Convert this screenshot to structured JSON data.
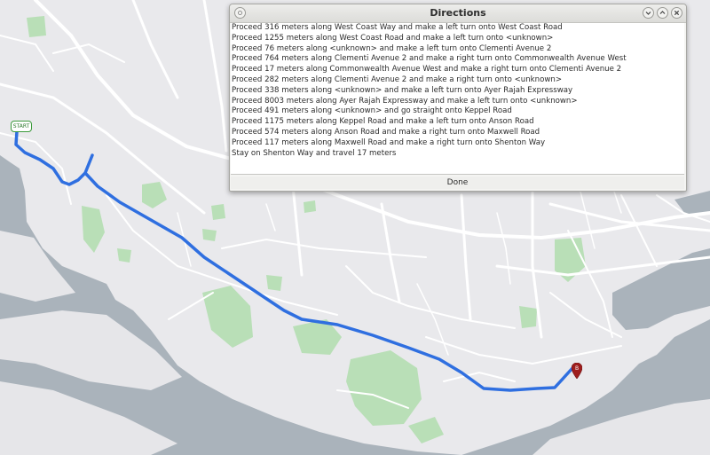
{
  "dialog": {
    "title": "Directions",
    "steps": [
      "Proceed 316 meters along West Coast Way and make a left turn onto West Coast Road",
      "Proceed 1255 meters along West Coast Road and make a left turn onto <unknown>",
      "Proceed 76 meters along <unknown> and make a left turn onto Clementi Avenue 2",
      "Proceed 764 meters along Clementi Avenue 2 and make a right turn onto Commonwealth Avenue West",
      "Proceed 17 meters along Commonwealth Avenue West and make a right turn onto Clementi Avenue 2",
      "Proceed 282 meters along Clementi Avenue 2 and make a right turn onto <unknown>",
      "Proceed 338 meters along <unknown> and make a left turn onto Ayer Rajah Expressway",
      "Proceed 8003 meters along Ayer Rajah Expressway and make a left turn onto <unknown>",
      "Proceed 491 meters along <unknown> and go straight onto Keppel Road",
      "Proceed 1175 meters along Keppel Road and make a left turn onto Anson Road",
      "Proceed 574 meters along Anson Road and make a right turn onto Maxwell Road",
      "Proceed 117 meters along Maxwell Road and make a right turn onto Shenton Way",
      "Stay on Shenton Way and travel 17 meters"
    ],
    "done_label": "Done"
  },
  "map": {
    "start_label": "START",
    "dest_label": "B",
    "route_color": "#2f6fe0",
    "water_color": "#aab3bb",
    "park_color": "#b9dfb7",
    "land_color": "#e9e9ec",
    "road_color": "#ffffff"
  },
  "icons": {
    "window_menu": "circle-icon",
    "minimize": "chevron-down-icon",
    "maximize": "chevron-up-icon",
    "close": "close-icon"
  }
}
